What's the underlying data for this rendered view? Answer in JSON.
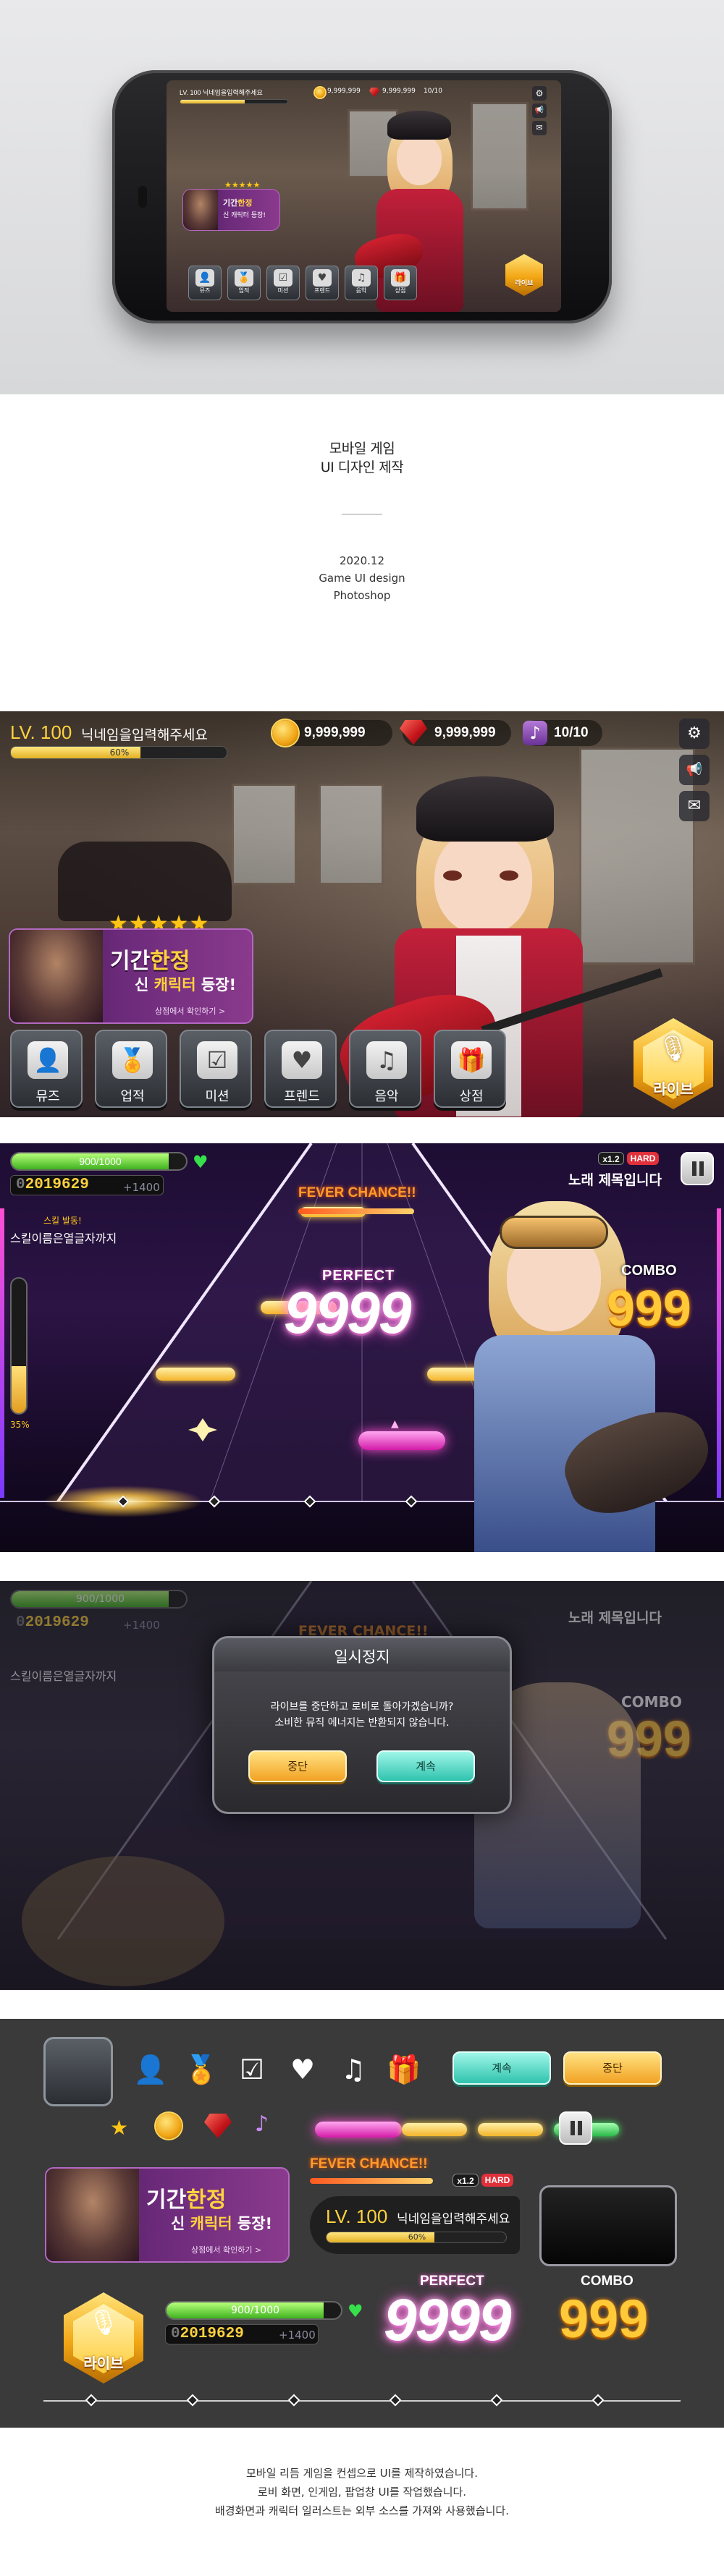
{
  "intro": {
    "title_line1": "모바일 게임",
    "title_line2": "UI 디자인 제작",
    "date": "2020.12",
    "subtitle": "Game UI design",
    "tool": "Photoshop"
  },
  "hud": {
    "level": "LV. 100",
    "nickname_placeholder": "닉네임을입력해주세요",
    "xp_percent_text": "60%",
    "xp_fraction": 0.6,
    "coins": "9,999,999",
    "gems": "9,999,999",
    "notes": "10/10"
  },
  "side_buttons": [
    {
      "icon": "gear-icon",
      "glyph": "⚙"
    },
    {
      "icon": "megaphone-icon",
      "glyph": "📢"
    },
    {
      "icon": "mail-icon",
      "glyph": "✉"
    }
  ],
  "banner": {
    "title_a": "기간",
    "title_b": "한정",
    "line2_a": "신 ",
    "line2_b": "캐릭터",
    "line2_c": " 등장!",
    "link": "상점에서 확인하기 >",
    "stars": "★★★★★"
  },
  "menu": [
    {
      "label": "뮤즈",
      "icon": "muse-icon",
      "glyph": "👤"
    },
    {
      "label": "업적",
      "icon": "medal-icon",
      "glyph": "🏅"
    },
    {
      "label": "미션",
      "icon": "clipboard-check-icon",
      "glyph": "☑"
    },
    {
      "label": "프렌드",
      "icon": "heart-smile-icon",
      "glyph": "♥"
    },
    {
      "label": "음악",
      "icon": "playlist-icon",
      "glyph": "♫"
    },
    {
      "label": "상점",
      "icon": "gift-icon",
      "glyph": "🎁"
    }
  ],
  "live_button": "라이브",
  "game": {
    "hp": "900/1000",
    "hp_fraction": 0.9,
    "score": "0",
    "score_value": "2019629",
    "score_delta": "+1400",
    "skill_label": "스킬 발동!",
    "skill_name": "스킬이름은열글자까지",
    "gauge_percent": "35%",
    "gauge_fraction": 0.35,
    "fever": "FEVER CHANCE!!",
    "judgement": "PERFECT",
    "combo_count": "9999",
    "combo_label": "COMBO",
    "combo_value": "999",
    "speed": "x1.2",
    "difficulty": "HARD",
    "song_title": "노래 제목입니다"
  },
  "pause": {
    "title": "일시정지",
    "message_line1": "라이브를 중단하고 로비로 돌아가겠습니까?",
    "message_line2": "소비한 뮤직 에너지는 반환되지 않습니다.",
    "stop": "중단",
    "continue": "계속"
  },
  "assets": {
    "continue": "계속",
    "stop": "중단",
    "fever": "FEVER CHANCE!!",
    "speed": "x1.2",
    "difficulty": "HARD",
    "level": "LV. 100",
    "nickname": "닉네임을입력해주세요",
    "xp": "60%",
    "hp": "900/1000",
    "score_value": "2019629",
    "score_prefix": "0",
    "score_delta": "+1400",
    "perfect": "PERFECT",
    "perfect_value": "9999",
    "combo": "COMBO",
    "combo_value": "999",
    "live": "라이브"
  },
  "footer": {
    "line1": "모바일 리듬 게임을 컨셉으로 UI를 제작하였습니다.",
    "line2": "로비 화면, 인게임, 팝업창 UI를 작업했습니다.",
    "line3": "배경화면과 캐릭터 일러스트는 외부 소스를 가져와 사용했습니다."
  },
  "colors": {
    "gold": "#f3a614",
    "mint": "#2fc3ae",
    "pink": "#d31aa8",
    "hp_green": "#3fb21f",
    "hard_red": "#e0303a"
  }
}
